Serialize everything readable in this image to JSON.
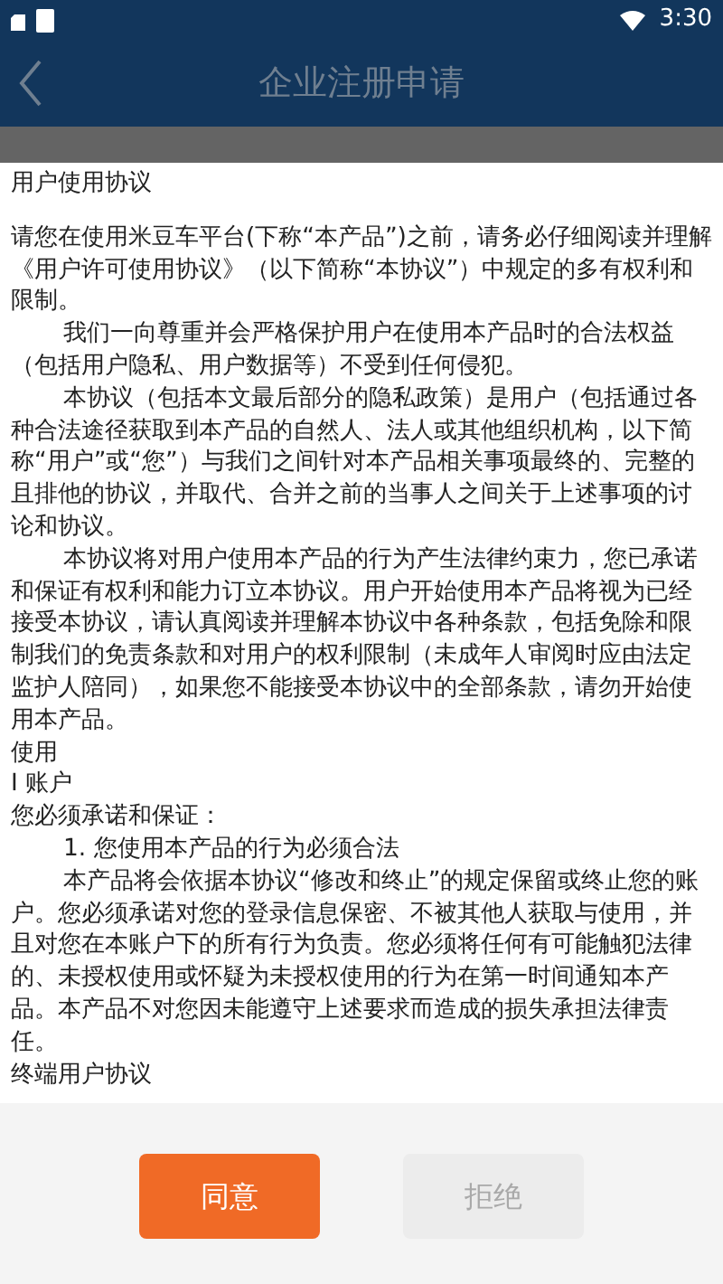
{
  "status_bar": {
    "time": "3:30"
  },
  "header": {
    "title": "企业注册申请"
  },
  "content": {
    "title": "用户使用协议",
    "paragraphs": [
      {
        "text": "请您在使用米豆车平台(下称“本产品”)之前，请务必仔细阅读并理解《用户许可使用协议》（以下简称“本协议”）中规定的多有权利和限制。",
        "indented": false
      },
      {
        "text": "我们一向尊重并会严格保护用户在使用本产品时的合法权益（包括用户隐私、用户数据等）不受到任何侵犯。",
        "indented": true
      },
      {
        "text": "本协议（包括本文最后部分的隐私政策）是用户（包括通过各种合法途径获取到本产品的自然人、法人或其他组织机构，以下简称“用户”或“您”）与我们之间针对本产品相关事项最终的、完整的且排他的协议，并取代、合并之前的当事人之间关于上述事项的讨论和协议。",
        "indented": true
      },
      {
        "text": "本协议将对用户使用本产品的行为产生法律约束力，您已承诺和保证有权利和能力订立本协议。用户开始使用本产品将视为已经接受本协议，请认真阅读并理解本协议中各种条款，包括免除和限制我们的免责条款和对用户的权利限制（未成年人审阅时应由法定监护人陪同），如果您不能接受本协议中的全部条款，请勿开始使用本产品。",
        "indented": true
      },
      {
        "text": "使用",
        "indented": false
      },
      {
        "text": "Ⅰ 账户",
        "indented": false
      },
      {
        "text": "您必须承诺和保证：",
        "indented": false
      },
      {
        "text": "1. 您使用本产品的行为必须合法",
        "indented": true
      },
      {
        "text": "本产品将会依据本协议“修改和终止”的规定保留或终止您的账户。您必须承诺对您的登录信息保密、不被其他人获取与使用，并且对您在本账户下的所有行为负责。您必须将任何有可能触犯法律的、未授权使用或怀疑为未授权使用的行为在第一时间通知本产品。本产品不对您因未能遵守上述要求而造成的损失承担法律责任。",
        "indented": true
      },
      {
        "text": "终端用户协议",
        "indented": false
      }
    ]
  },
  "buttons": [
    {
      "label": "同意",
      "kind": "primary",
      "disabled": false
    },
    {
      "label": "拒绝",
      "kind": "secondary",
      "disabled": true
    }
  ]
}
